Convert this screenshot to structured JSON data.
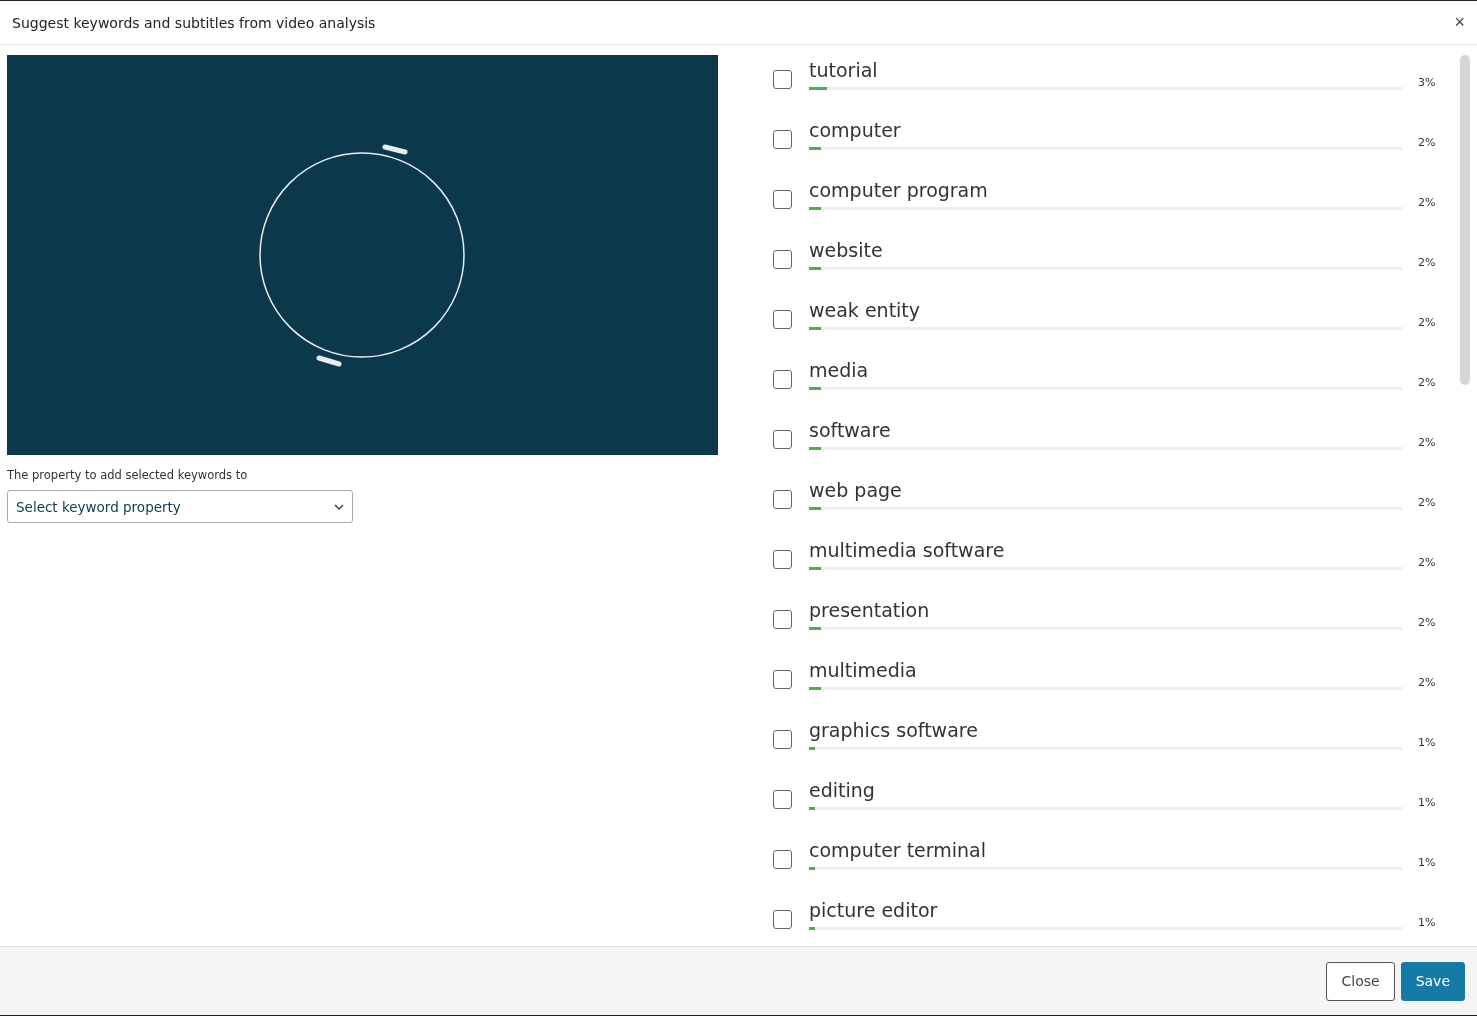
{
  "window": {
    "title": "Suggest keywords and subtitles from video analysis",
    "close": "×"
  },
  "property": {
    "label": "The property to add selected keywords to",
    "placeholder": "Select keyword property"
  },
  "keywords": [
    {
      "name": "tutorial",
      "checked": false,
      "level": 0.03,
      "reading": "3%"
    },
    {
      "name": "computer",
      "checked": false,
      "level": 0.02,
      "reading": "2%"
    },
    {
      "name": "computer program",
      "checked": false,
      "level": 0.02,
      "reading": "2%"
    },
    {
      "name": "website",
      "checked": false,
      "level": 0.02,
      "reading": "2%"
    },
    {
      "name": "weak entity",
      "checked": false,
      "level": 0.02,
      "reading": "2%"
    },
    {
      "name": "media",
      "checked": false,
      "level": 0.02,
      "reading": "2%"
    },
    {
      "name": "software",
      "checked": false,
      "level": 0.02,
      "reading": "2%"
    },
    {
      "name": "web page",
      "checked": false,
      "level": 0.02,
      "reading": "2%"
    },
    {
      "name": "multimedia software",
      "checked": false,
      "level": 0.02,
      "reading": "2%"
    },
    {
      "name": "presentation",
      "checked": false,
      "level": 0.02,
      "reading": "2%"
    },
    {
      "name": "multimedia",
      "checked": false,
      "level": 0.02,
      "reading": "2%"
    },
    {
      "name": "graphics software",
      "checked": false,
      "level": 0.01,
      "reading": "1%"
    },
    {
      "name": "editing",
      "checked": false,
      "level": 0.01,
      "reading": "1%"
    },
    {
      "name": "computer terminal",
      "checked": false,
      "level": 0.01,
      "reading": "1%"
    },
    {
      "name": "picture editor",
      "checked": false,
      "level": 0.01,
      "reading": "1%"
    }
  ],
  "buttons": [
    {
      "label": "Close",
      "kind": "secondary"
    },
    {
      "label": "Save",
      "kind": "primary"
    }
  ]
}
